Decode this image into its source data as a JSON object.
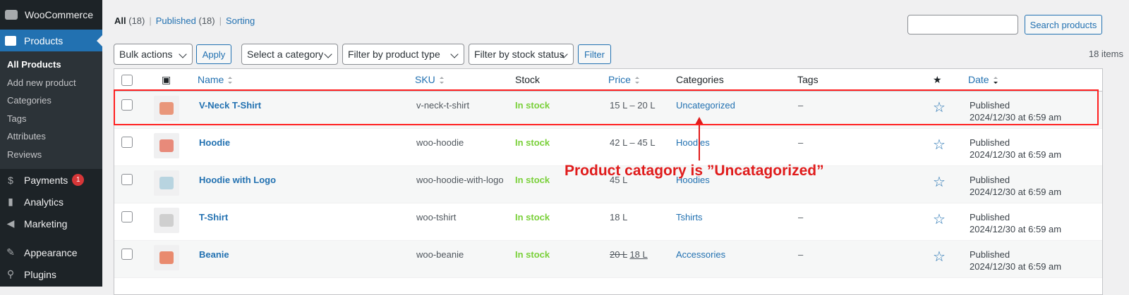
{
  "sidebar": {
    "woocommerce": "WooCommerce",
    "products": "Products",
    "sub": [
      "All Products",
      "Add new product",
      "Categories",
      "Tags",
      "Attributes",
      "Reviews"
    ],
    "payments": "Payments",
    "payments_badge": "1",
    "analytics": "Analytics",
    "marketing": "Marketing",
    "appearance": "Appearance",
    "plugins": "Plugins"
  },
  "views": {
    "all": "All",
    "all_count": "(18)",
    "published": "Published",
    "published_count": "(18)",
    "sorting": "Sorting"
  },
  "toolbar": {
    "bulk_actions": "Bulk actions",
    "apply": "Apply",
    "category": "Select a category",
    "product_type": "Filter by product type",
    "stock_status": "Filter by stock status",
    "filter": "Filter",
    "items": "18 items",
    "search_button": "Search products",
    "search_value": ""
  },
  "table": {
    "columns": {
      "name": "Name",
      "sku": "SKU",
      "stock": "Stock",
      "price": "Price",
      "categories": "Categories",
      "tags": "Tags",
      "date": "Date"
    },
    "rows": [
      {
        "name": "V-Neck T-Shirt",
        "sku": "v-neck-t-shirt",
        "stock": "In stock",
        "price": "15 L – 20 L",
        "category": "Uncategorized",
        "tags": "–",
        "date1": "Published",
        "date2": "2024/12/30 at 6:59 am",
        "color": "#e9967a"
      },
      {
        "name": "Hoodie",
        "sku": "woo-hoodie",
        "stock": "In stock",
        "price": "42 L – 45 L",
        "category": "Hoodies",
        "tags": "–",
        "date1": "Published",
        "date2": "2024/12/30 at 6:59 am",
        "color": "#e88a7a"
      },
      {
        "name": "Hoodie with Logo",
        "sku": "woo-hoodie-with-logo",
        "stock": "In stock",
        "price": "45 L",
        "category": "Hoodies",
        "tags": "",
        "date1": "Published",
        "date2": "2024/12/30 at 6:59 am",
        "color": "#b8d4e0"
      },
      {
        "name": "T-Shirt",
        "sku": "woo-tshirt",
        "stock": "In stock",
        "price": "18 L",
        "category": "Tshirts",
        "tags": "–",
        "date1": "Published",
        "date2": "2024/12/30 at 6:59 am",
        "color": "#cfcfcf"
      },
      {
        "name": "Beanie",
        "sku": "woo-beanie",
        "stock": "In stock",
        "price_old": "20 L",
        "price": "18 L",
        "category": "Accessories",
        "tags": "–",
        "date1": "Published",
        "date2": "2024/12/30 at 6:59 am",
        "color": "#e98a6e"
      }
    ]
  },
  "annotation": {
    "text": "Product catagory is ”Uncatagorized”",
    "color": "#e01b1b"
  }
}
